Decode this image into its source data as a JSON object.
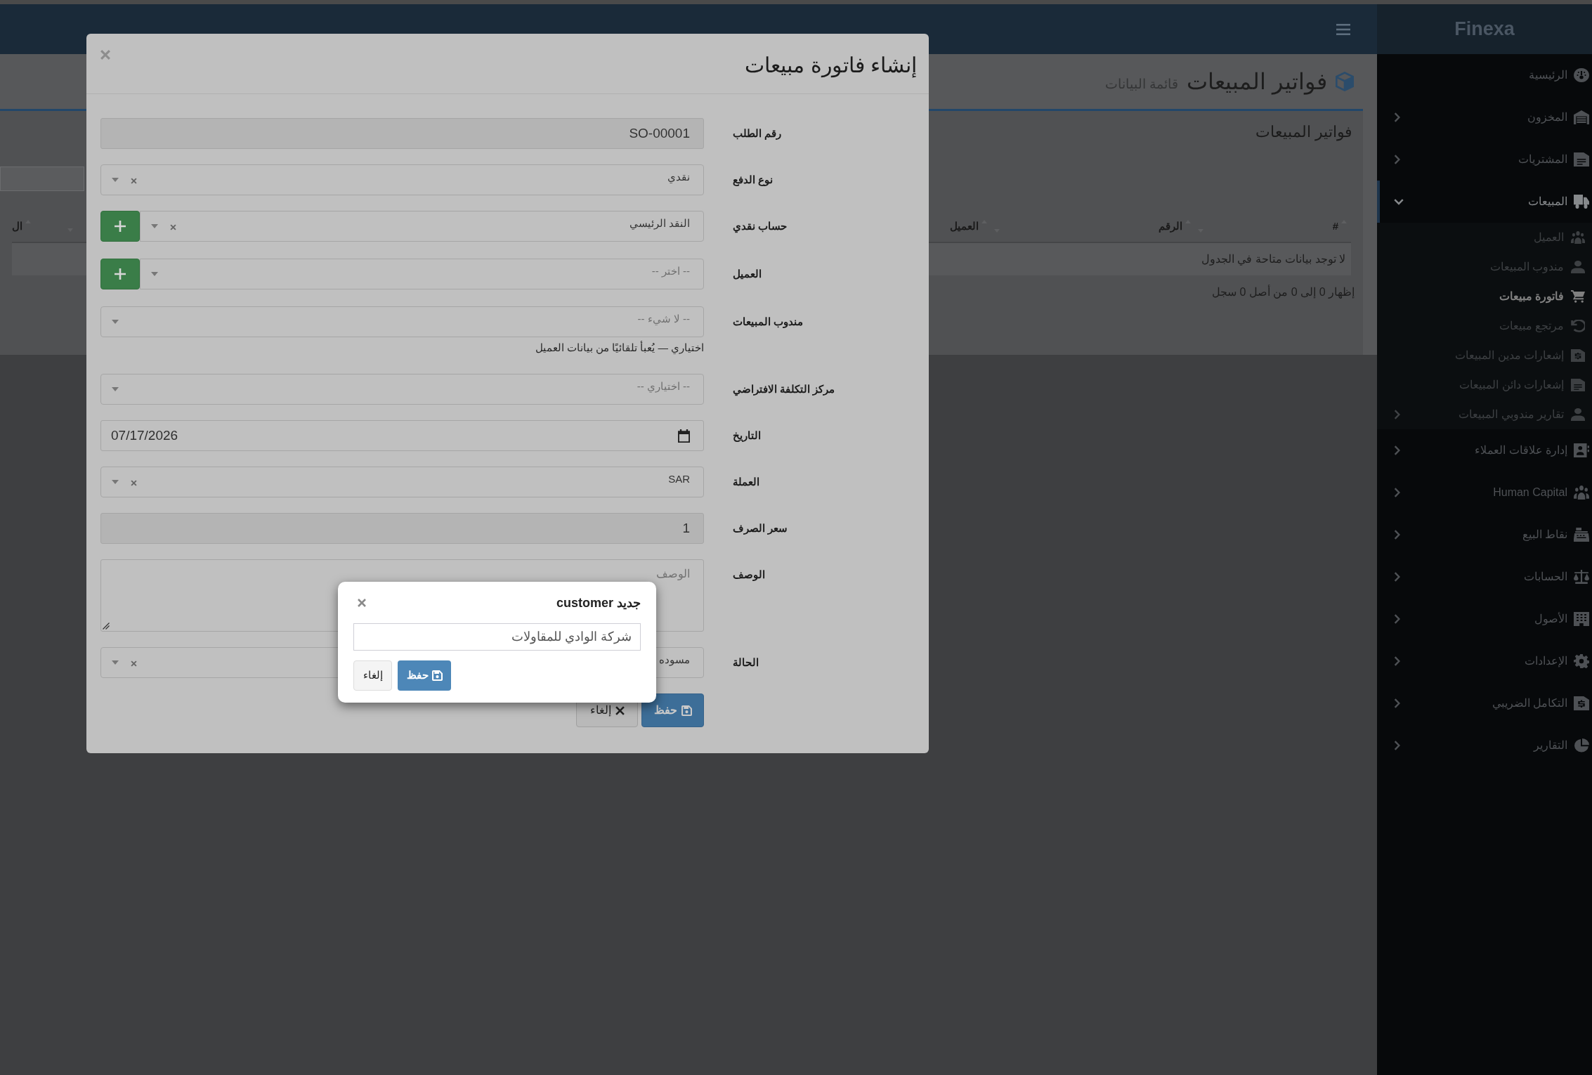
{
  "sidebar": {
    "brand": "Finexa",
    "items": [
      {
        "label": "الرئيسية",
        "kind": "link",
        "selected": false
      },
      {
        "label": "المخزون",
        "kind": "group",
        "expanded": false,
        "selected": false
      },
      {
        "label": "المشتريات",
        "kind": "group",
        "expanded": false,
        "selected": false
      },
      {
        "label": "المبيعات",
        "kind": "group",
        "expanded": true,
        "selected": true,
        "children": [
          {
            "label": "العميل",
            "kind": "link",
            "selected": false
          },
          {
            "label": "مندوب المبيعات",
            "kind": "link",
            "selected": false
          },
          {
            "label": "فاتورة مبيعات",
            "kind": "link",
            "selected": true
          },
          {
            "label": "مرتجع مبيعات",
            "kind": "link",
            "selected": false
          },
          {
            "label": "إشعارات مدين المبيعات",
            "kind": "link",
            "selected": false
          },
          {
            "label": "إشعارات دائن المبيعات",
            "kind": "link",
            "selected": false
          },
          {
            "label": "تقارير مندوبي المبيعات",
            "kind": "group",
            "expanded": false,
            "selected": false
          }
        ]
      },
      {
        "label": "إدارة علاقات العملاء",
        "kind": "group",
        "expanded": false,
        "selected": false
      },
      {
        "label": "Human Capital",
        "kind": "group",
        "expanded": false,
        "selected": false
      },
      {
        "label": "نقاط البيع",
        "kind": "group",
        "expanded": false,
        "selected": false
      },
      {
        "label": "الحسابات",
        "kind": "group",
        "expanded": false,
        "selected": false
      },
      {
        "label": "الأصول",
        "kind": "group",
        "expanded": false,
        "selected": false
      },
      {
        "label": "الإعدادات",
        "kind": "group",
        "expanded": false,
        "selected": false
      },
      {
        "label": "التكامل الضريبي",
        "kind": "group",
        "expanded": false,
        "selected": false
      },
      {
        "label": "التقارير",
        "kind": "group",
        "expanded": false,
        "selected": false
      }
    ]
  },
  "page": {
    "title": "فواتير المبيعات",
    "subtitle": "قائمة البيانات"
  },
  "panel": {
    "title": "فواتير المبيعات",
    "table": {
      "columns": [
        {
          "label": "#"
        },
        {
          "label": "الرقم"
        },
        {
          "label": "العميل"
        },
        {
          "label": "ال"
        }
      ],
      "empty_message": "لا توجد بيانات متاحة في الجدول"
    },
    "info": "إظهار 0 إلى 0 من أصل 0 سجل"
  },
  "modal": {
    "title": "إنشاء فاتورة مبيعات",
    "fields": [
      {
        "label": "رقم الطلب",
        "kind": "readonly",
        "value": "SO-00001",
        "add_button": false
      },
      {
        "label": "نوع الدفع",
        "kind": "select",
        "value": "نقدي",
        "add_button": false
      },
      {
        "label": "حساب نقدي",
        "kind": "select",
        "value": "النقد الرئيسي",
        "add_button": true
      },
      {
        "label": "العميل",
        "kind": "select",
        "placeholder": "-- اختر --",
        "add_button": true
      },
      {
        "label": "مندوب المبيعات",
        "kind": "select",
        "placeholder": "-- لا شيء --",
        "help": "اختياري — يُعبأ تلقائيًا من بيانات العميل",
        "add_button": false
      },
      {
        "label": "مركز التكلفة الافتراضي",
        "kind": "select",
        "placeholder": "-- اختياري --",
        "add_button": false
      },
      {
        "label": "التاريخ",
        "kind": "date",
        "value": "07/17/2026",
        "add_button": false
      },
      {
        "label": "العملة",
        "kind": "select",
        "value": "SAR",
        "add_button": false
      },
      {
        "label": "سعر الصرف",
        "kind": "readonly",
        "value": "1",
        "add_button": false
      },
      {
        "label": "الوصف",
        "kind": "textarea",
        "placeholder": "الوصف",
        "add_button": false
      },
      {
        "label": "الحالة",
        "kind": "select",
        "value": "مسوده",
        "add_button": false
      }
    ],
    "buttons": [
      {
        "label": "حفظ",
        "kind": "primary"
      },
      {
        "label": "إلغاء",
        "kind": "default"
      }
    ]
  },
  "dialog": {
    "title": "جديد customer",
    "input": {
      "value": "شركة الوادي للمقاولات"
    },
    "buttons": [
      {
        "label": "حفظ",
        "kind": "primary"
      },
      {
        "label": "إلغاء",
        "kind": "default"
      }
    ]
  }
}
